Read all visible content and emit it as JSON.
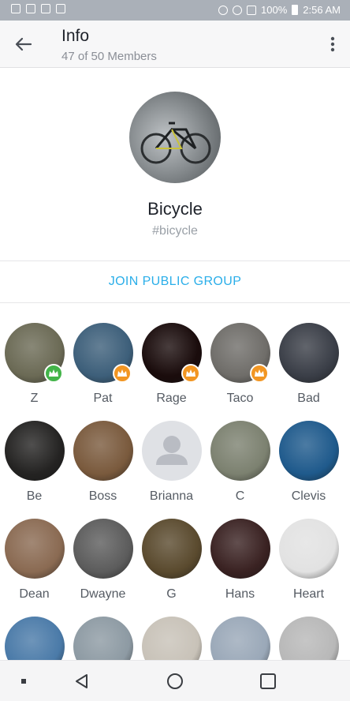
{
  "status_bar": {
    "battery": "100%",
    "time": "2:56 AM"
  },
  "header": {
    "title": "Info",
    "subtitle": "47 of 50 Members"
  },
  "group": {
    "name": "Bicycle",
    "tag": "#bicycle",
    "join_label": "JOIN PUBLIC GROUP"
  },
  "members": [
    {
      "name": "Z",
      "badge": "green-crown",
      "bg": "#6b6a55"
    },
    {
      "name": "Pat",
      "badge": "orange-crown",
      "bg": "#3d5f7a"
    },
    {
      "name": "Rage",
      "badge": "orange-crown",
      "bg": "#1a0c0c"
    },
    {
      "name": "Taco",
      "badge": "orange-crown",
      "bg": "#6f6d69"
    },
    {
      "name": "Bad",
      "badge": "",
      "bg": "#3a3e47"
    },
    {
      "name": "Be",
      "badge": "",
      "bg": "#242322"
    },
    {
      "name": "Boss",
      "badge": "",
      "bg": "#7a5a3d"
    },
    {
      "name": "Brianna",
      "badge": "",
      "bg": "placeholder"
    },
    {
      "name": "C",
      "badge": "",
      "bg": "#7c8170"
    },
    {
      "name": "Clevis",
      "badge": "",
      "bg": "#1f5a8c"
    },
    {
      "name": "Dean",
      "badge": "",
      "bg": "#8a6a52"
    },
    {
      "name": "Dwayne",
      "badge": "",
      "bg": "#5c5c5c"
    },
    {
      "name": "G",
      "badge": "",
      "bg": "#5a4a2e"
    },
    {
      "name": "Hans",
      "badge": "",
      "bg": "#3a2222"
    },
    {
      "name": "Heart",
      "badge": "",
      "bg": "#e2e2e2"
    },
    {
      "name": "",
      "badge": "",
      "bg": "#4a7aa8"
    },
    {
      "name": "",
      "badge": "",
      "bg": "#8d9aa3"
    },
    {
      "name": "",
      "badge": "",
      "bg": "#c8c2b8"
    },
    {
      "name": "",
      "badge": "",
      "bg": "#9aa8b8"
    },
    {
      "name": "",
      "badge": "",
      "bg": "#b8b8b8"
    }
  ],
  "colors": {
    "accent": "#2aaee9",
    "green_badge": "#43b449",
    "orange_badge": "#f29623"
  },
  "icons": {
    "back": "arrow-left-icon",
    "menu": "more-vertical-icon",
    "nav_back": "triangle-back-icon",
    "nav_home": "circle-home-icon",
    "nav_recents": "square-recents-icon"
  }
}
